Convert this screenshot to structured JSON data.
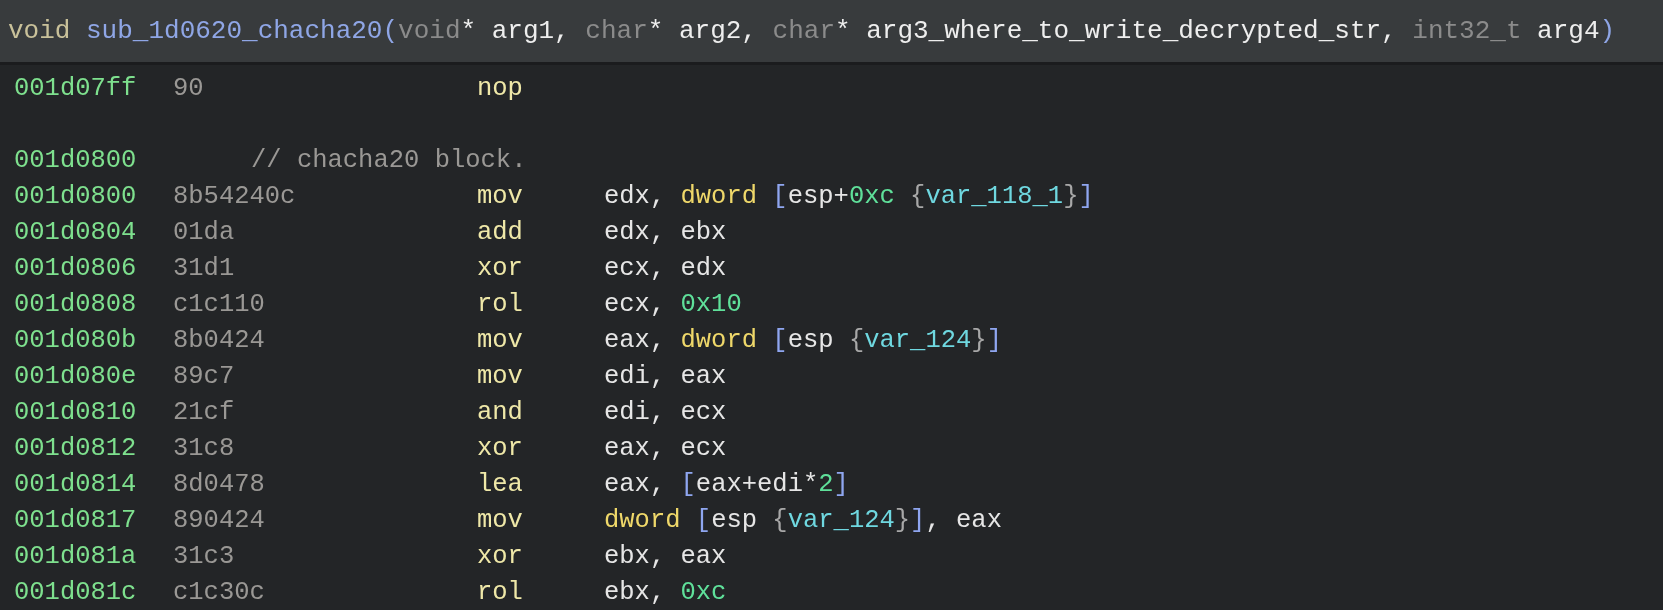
{
  "header": {
    "signature": [
      {
        "kind": "type",
        "text": "void "
      },
      {
        "kind": "name",
        "text": "sub_1d0620_chacha20"
      },
      {
        "kind": "paren",
        "text": "("
      },
      {
        "kind": "ptype",
        "text": "void"
      },
      {
        "kind": "plain",
        "text": "* arg1, "
      },
      {
        "kind": "ptype",
        "text": "char"
      },
      {
        "kind": "plain",
        "text": "* arg2, "
      },
      {
        "kind": "ptype",
        "text": "char"
      },
      {
        "kind": "plain",
        "text": "* arg3_where_to_write_decrypted_str, "
      },
      {
        "kind": "ptype",
        "text": "int32_t"
      },
      {
        "kind": "plain",
        "text": " arg4"
      },
      {
        "kind": "paren",
        "text": ")"
      }
    ]
  },
  "rows": [
    {
      "kind": "instruction",
      "address": "001d07ff",
      "bytes": "90",
      "mnemonic": "nop",
      "operands": []
    },
    {
      "kind": "blank"
    },
    {
      "kind": "comment",
      "address": "001d0800",
      "comment": "// chacha20 block."
    },
    {
      "kind": "instruction",
      "address": "001d0800",
      "bytes": "8b54240c",
      "mnemonic": "mov",
      "operands": [
        {
          "kind": "reg",
          "text": "edx, "
        },
        {
          "kind": "size",
          "text": "dword "
        },
        {
          "kind": "bracket",
          "text": "["
        },
        {
          "kind": "reg",
          "text": "esp+"
        },
        {
          "kind": "num",
          "text": "0xc"
        },
        {
          "kind": "brace",
          "text": " {"
        },
        {
          "kind": "var",
          "text": "var_118_1"
        },
        {
          "kind": "brace",
          "text": "}"
        },
        {
          "kind": "bracket",
          "text": "]"
        }
      ]
    },
    {
      "kind": "instruction",
      "address": "001d0804",
      "bytes": "01da",
      "mnemonic": "add",
      "operands": [
        {
          "kind": "reg",
          "text": "edx, ebx"
        }
      ]
    },
    {
      "kind": "instruction",
      "address": "001d0806",
      "bytes": "31d1",
      "mnemonic": "xor",
      "operands": [
        {
          "kind": "reg",
          "text": "ecx, edx"
        }
      ]
    },
    {
      "kind": "instruction",
      "address": "001d0808",
      "bytes": "c1c110",
      "mnemonic": "rol",
      "operands": [
        {
          "kind": "reg",
          "text": "ecx, "
        },
        {
          "kind": "num",
          "text": "0x10"
        }
      ]
    },
    {
      "kind": "instruction",
      "address": "001d080b",
      "bytes": "8b0424",
      "mnemonic": "mov",
      "operands": [
        {
          "kind": "reg",
          "text": "eax, "
        },
        {
          "kind": "size",
          "text": "dword "
        },
        {
          "kind": "bracket",
          "text": "["
        },
        {
          "kind": "reg",
          "text": "esp "
        },
        {
          "kind": "brace",
          "text": "{"
        },
        {
          "kind": "var",
          "text": "var_124"
        },
        {
          "kind": "brace",
          "text": "}"
        },
        {
          "kind": "bracket",
          "text": "]"
        }
      ]
    },
    {
      "kind": "instruction",
      "address": "001d080e",
      "bytes": "89c7",
      "mnemonic": "mov",
      "operands": [
        {
          "kind": "reg",
          "text": "edi, eax"
        }
      ]
    },
    {
      "kind": "instruction",
      "address": "001d0810",
      "bytes": "21cf",
      "mnemonic": "and",
      "operands": [
        {
          "kind": "reg",
          "text": "edi, ecx"
        }
      ]
    },
    {
      "kind": "instruction",
      "address": "001d0812",
      "bytes": "31c8",
      "mnemonic": "xor",
      "operands": [
        {
          "kind": "reg",
          "text": "eax, ecx"
        }
      ]
    },
    {
      "kind": "instruction",
      "address": "001d0814",
      "bytes": "8d0478",
      "mnemonic": "lea",
      "operands": [
        {
          "kind": "reg",
          "text": "eax, "
        },
        {
          "kind": "bracket",
          "text": "["
        },
        {
          "kind": "reg",
          "text": "eax+edi*"
        },
        {
          "kind": "num",
          "text": "2"
        },
        {
          "kind": "bracket",
          "text": "]"
        }
      ]
    },
    {
      "kind": "instruction",
      "address": "001d0817",
      "bytes": "890424",
      "mnemonic": "mov",
      "operands": [
        {
          "kind": "size",
          "text": "dword "
        },
        {
          "kind": "bracket",
          "text": "["
        },
        {
          "kind": "reg",
          "text": "esp "
        },
        {
          "kind": "brace",
          "text": "{"
        },
        {
          "kind": "var",
          "text": "var_124"
        },
        {
          "kind": "brace",
          "text": "}"
        },
        {
          "kind": "bracket",
          "text": "]"
        },
        {
          "kind": "reg",
          "text": ", eax"
        }
      ]
    },
    {
      "kind": "instruction",
      "address": "001d081a",
      "bytes": "31c3",
      "mnemonic": "xor",
      "operands": [
        {
          "kind": "reg",
          "text": "ebx, eax"
        }
      ]
    },
    {
      "kind": "instruction",
      "address": "001d081c",
      "bytes": "c1c30c",
      "mnemonic": "rol",
      "operands": [
        {
          "kind": "reg",
          "text": "ebx, "
        },
        {
          "kind": "num",
          "text": "0xc"
        }
      ]
    }
  ]
}
